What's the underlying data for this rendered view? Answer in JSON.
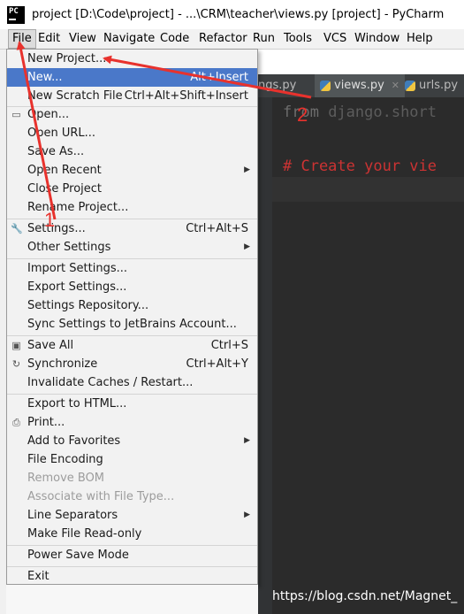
{
  "window": {
    "title": "project [D:\\Code\\project] - ...\\CRM\\teacher\\views.py [project] - PyCharm",
    "app_icon_text": "PC"
  },
  "menubar": [
    {
      "label": "File",
      "active": true
    },
    {
      "label": "Edit"
    },
    {
      "label": "View"
    },
    {
      "label": "Navigate"
    },
    {
      "label": "Code"
    },
    {
      "label": "Refactor"
    },
    {
      "label": "Run"
    },
    {
      "label": "Tools"
    },
    {
      "label": "VCS"
    },
    {
      "label": "Window"
    },
    {
      "label": "Help"
    }
  ],
  "editor": {
    "tabs": [
      {
        "label": "ngs.py",
        "selected": false
      },
      {
        "label": "views.py",
        "selected": true
      },
      {
        "label": "urls.py",
        "selected": false
      }
    ],
    "code_line1_keyword": "from",
    "code_line1_rest": " django.short",
    "code_comment": "# Create your vie",
    "accent": "#cc3333"
  },
  "file_menu": {
    "items": [
      {
        "label": "New Project...",
        "shortcut": ""
      },
      {
        "label": "New...",
        "shortcut": "Alt+Insert",
        "highlighted": true
      },
      {
        "label": "New Scratch File",
        "shortcut": "Ctrl+Alt+Shift+Insert"
      },
      {
        "label": "Open...",
        "shortcut": "",
        "icon": "folder-icon"
      },
      {
        "label": "Open URL...",
        "shortcut": ""
      },
      {
        "label": "Save As...",
        "shortcut": ""
      },
      {
        "label": "Open Recent",
        "shortcut": "",
        "submenu": true
      },
      {
        "label": "Close Project",
        "shortcut": ""
      },
      {
        "label": "Rename Project...",
        "shortcut": ""
      },
      {
        "label": "Settings...",
        "shortcut": "Ctrl+Alt+S",
        "icon": "wrench-icon"
      },
      {
        "label": "Other Settings",
        "shortcut": "",
        "submenu": true
      },
      {
        "label": "Import Settings...",
        "shortcut": ""
      },
      {
        "label": "Export Settings...",
        "shortcut": ""
      },
      {
        "label": "Settings Repository...",
        "shortcut": ""
      },
      {
        "label": "Sync Settings to JetBrains Account...",
        "shortcut": ""
      },
      {
        "label": "Save All",
        "shortcut": "Ctrl+S",
        "icon": "save-icon"
      },
      {
        "label": "Synchronize",
        "shortcut": "Ctrl+Alt+Y",
        "icon": "sync-icon"
      },
      {
        "label": "Invalidate Caches / Restart...",
        "shortcut": ""
      },
      {
        "label": "Export to HTML...",
        "shortcut": ""
      },
      {
        "label": "Print...",
        "shortcut": "",
        "icon": "print-icon"
      },
      {
        "label": "Add to Favorites",
        "shortcut": "",
        "submenu": true
      },
      {
        "label": "File Encoding",
        "shortcut": ""
      },
      {
        "label": "Remove BOM",
        "shortcut": "",
        "disabled": true
      },
      {
        "label": "Associate with File Type...",
        "shortcut": "",
        "disabled": true
      },
      {
        "label": "Line Separators",
        "shortcut": "",
        "submenu": true
      },
      {
        "label": "Make File Read-only",
        "shortcut": ""
      },
      {
        "label": "Power Save Mode",
        "shortcut": ""
      },
      {
        "label": "Exit",
        "shortcut": ""
      }
    ]
  },
  "annotations": {
    "marker_1": "1",
    "marker_2": "2",
    "arrow_color": "#e8322d"
  },
  "watermark": "https://blog.csdn.net/Magnet_"
}
